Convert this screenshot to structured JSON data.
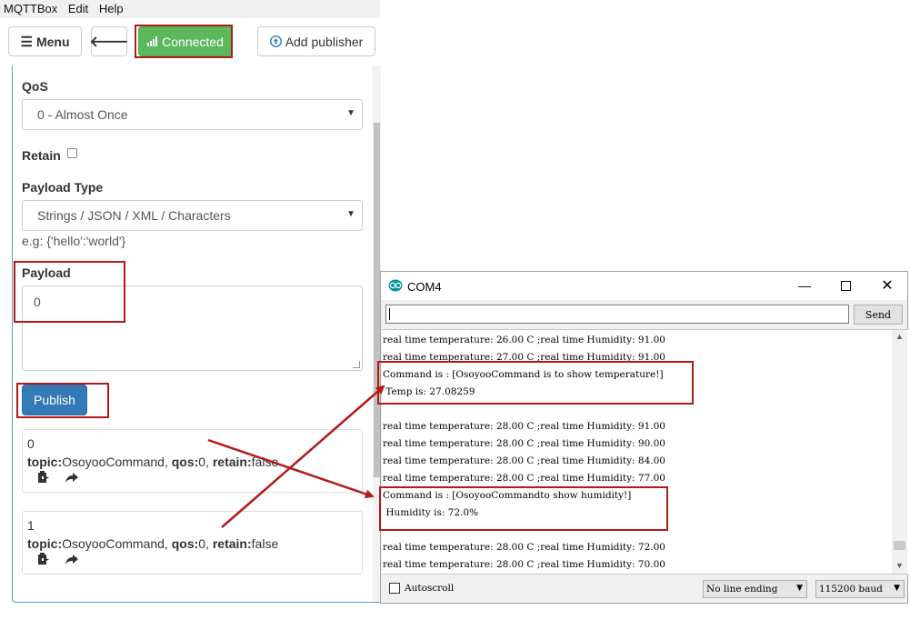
{
  "mqttbox": {
    "menubar": [
      "MQTTBox",
      "Edit",
      "Help"
    ],
    "toolbar": {
      "menu_label": "Menu",
      "menu_icon": "hamburger-icon",
      "back_icon": "arrow-left-icon",
      "connected_label": "Connected",
      "connected_icon": "signal-bars-icon",
      "add_publisher_label": "Add publisher",
      "add_publisher_icon": "circle-arrow-up-icon"
    },
    "qos": {
      "label": "QoS",
      "value": "0 - Almost Once"
    },
    "retain": {
      "label": "Retain",
      "checked": false
    },
    "payload_type": {
      "label": "Payload Type",
      "value": "Strings / JSON / XML / Characters",
      "hint": "e.g: {'hello':'world'}"
    },
    "payload": {
      "label": "Payload",
      "value": "0"
    },
    "publish_label": "Publish",
    "messages": [
      {
        "index": "0",
        "topic_key": "topic:",
        "topic": "OsoyooCommand",
        "qos_key": "qos:",
        "qos": "0",
        "retain_key": "retain:",
        "retain": "false"
      },
      {
        "index": "1",
        "topic_key": "topic:",
        "topic": "OsoyooCommand",
        "qos_key": "qos:",
        "qos": "0",
        "retain_key": "retain:",
        "retain": "false"
      }
    ],
    "colors": {
      "connected": "#5cb85c",
      "publish": "#337ab7",
      "highlight": "#b21a1a"
    }
  },
  "serial": {
    "title": "COM4",
    "send_label": "Send",
    "lines": [
      "real time temperature: 26.00 C ;real time Humidity: 91.00",
      "real time temperature: 27.00 C ;real time Humidity: 91.00",
      "Command is : [OsoyooCommand is to show temperature!]",
      " Temp is: 27.08259",
      "",
      "real time temperature: 28.00 C ;real time Humidity: 91.00",
      "real time temperature: 28.00 C ;real time Humidity: 90.00",
      "real time temperature: 28.00 C ;real time Humidity: 84.00",
      "real time temperature: 28.00 C ;real time Humidity: 77.00",
      "Command is : [OsoyooCommandto show humidity!]",
      " Humidity is: 72.0%",
      "",
      "real time temperature: 28.00 C ;real time Humidity: 72.00",
      "real time temperature: 28.00 C ;real time Humidity: 70.00"
    ],
    "autoscroll_label": "Autoscroll",
    "autoscroll_checked": false,
    "line_ending": "No line ending",
    "baud": "115200 baud"
  }
}
